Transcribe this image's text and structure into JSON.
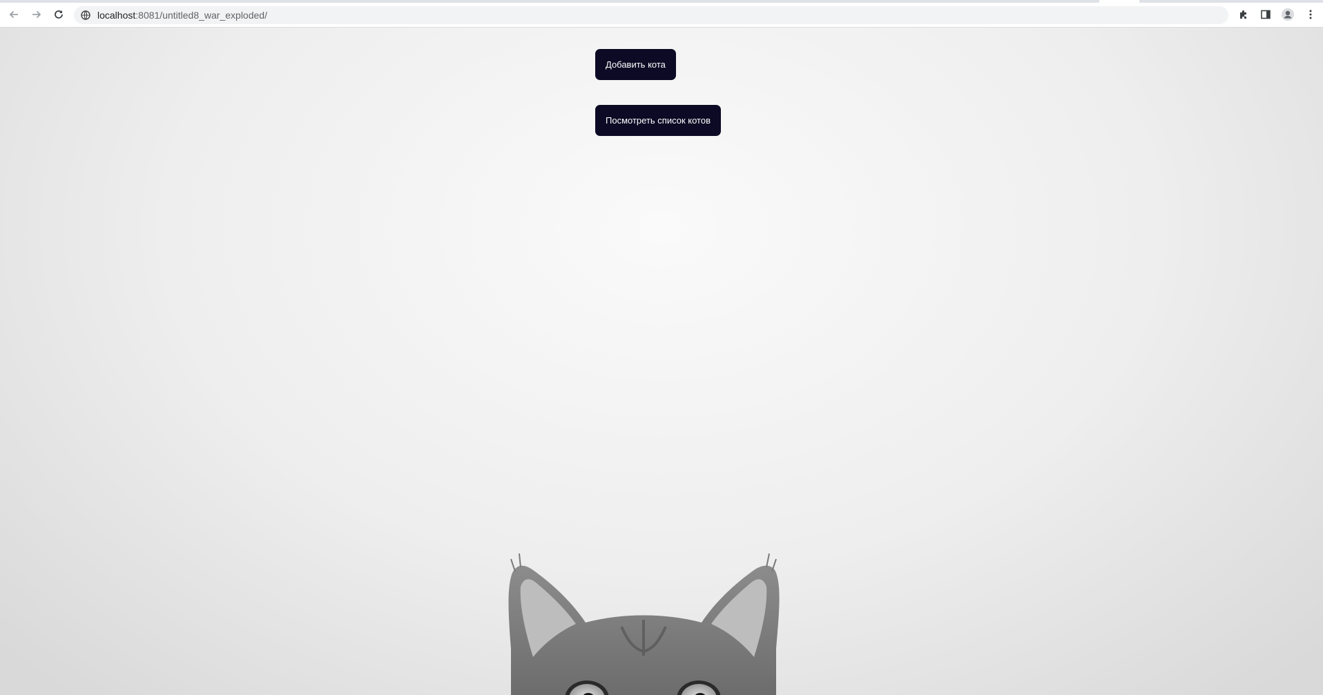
{
  "browser": {
    "url_host": "localhost",
    "url_path": ":8081/untitled8_war_exploded/",
    "icons": {
      "back": "arrow-left-icon",
      "forward": "arrow-right-icon",
      "reload": "reload-icon",
      "site_info": "globe-icon",
      "extensions": "puzzle-icon",
      "side_panel": "side-panel-icon",
      "profile": "profile-avatar-icon",
      "menu": "kebab-menu-icon"
    }
  },
  "page": {
    "buttons": {
      "add_cat": "Добавить кота",
      "view_cats": "Посмотреть список котов"
    },
    "button_color": "#0c0a24",
    "background_image": "peeking-cat-photo"
  }
}
